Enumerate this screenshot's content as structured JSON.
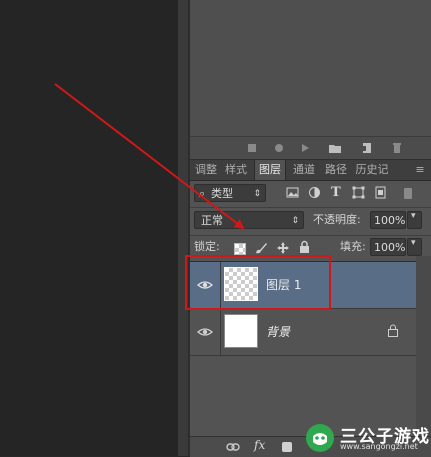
{
  "panel": {
    "tabs": [
      "调整",
      "样式",
      "图层",
      "通道",
      "路径",
      "历史记"
    ],
    "active_tab": "图层",
    "filter": {
      "label": "类型"
    },
    "blend_mode": "正常",
    "opacity_label": "不透明度:",
    "opacity_value": "100%",
    "lock_label": "锁定:",
    "fill_label": "填充:",
    "fill_value": "100%"
  },
  "layers": [
    {
      "name": "图层 1",
      "selected": true,
      "thumbnail": "transparent"
    },
    {
      "name": "背景",
      "selected": false,
      "thumbnail": "white",
      "locked": true
    }
  ],
  "bottom_bar": {
    "fx_label": "fx"
  },
  "watermark": {
    "title": "三公子游戏网",
    "url": "www.sangongzi.net"
  },
  "colors": {
    "panel_bg": "#535353",
    "selected_layer": "#596d86",
    "annotation": "#d01818"
  }
}
